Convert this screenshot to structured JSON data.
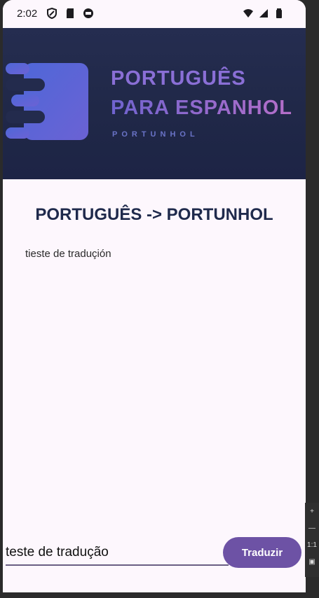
{
  "statusbar": {
    "time": "2:02",
    "left_icons": [
      "shield-icon",
      "sd-card-icon",
      "android-icon"
    ],
    "right_icons": [
      "wifi-icon",
      "signal-icon",
      "battery-icon"
    ]
  },
  "banner": {
    "line1": "PORTUGUÊS",
    "line2": "PARA ESPANHOL",
    "sub": "PORTUNHOL",
    "colors": {
      "background": "#222a4b",
      "accent": "#8a6fd6",
      "logo": "#4f67d8"
    }
  },
  "main": {
    "heading": "PORTUGUÊS -> PORTUNHOL",
    "output": "tieste de traduçión"
  },
  "input": {
    "value": "teste de tradução",
    "button_label": "Traduzir",
    "button_color": "#6d52a5"
  },
  "side_toolbar": {
    "items": [
      "+",
      "—",
      "1:1",
      "▣"
    ]
  }
}
